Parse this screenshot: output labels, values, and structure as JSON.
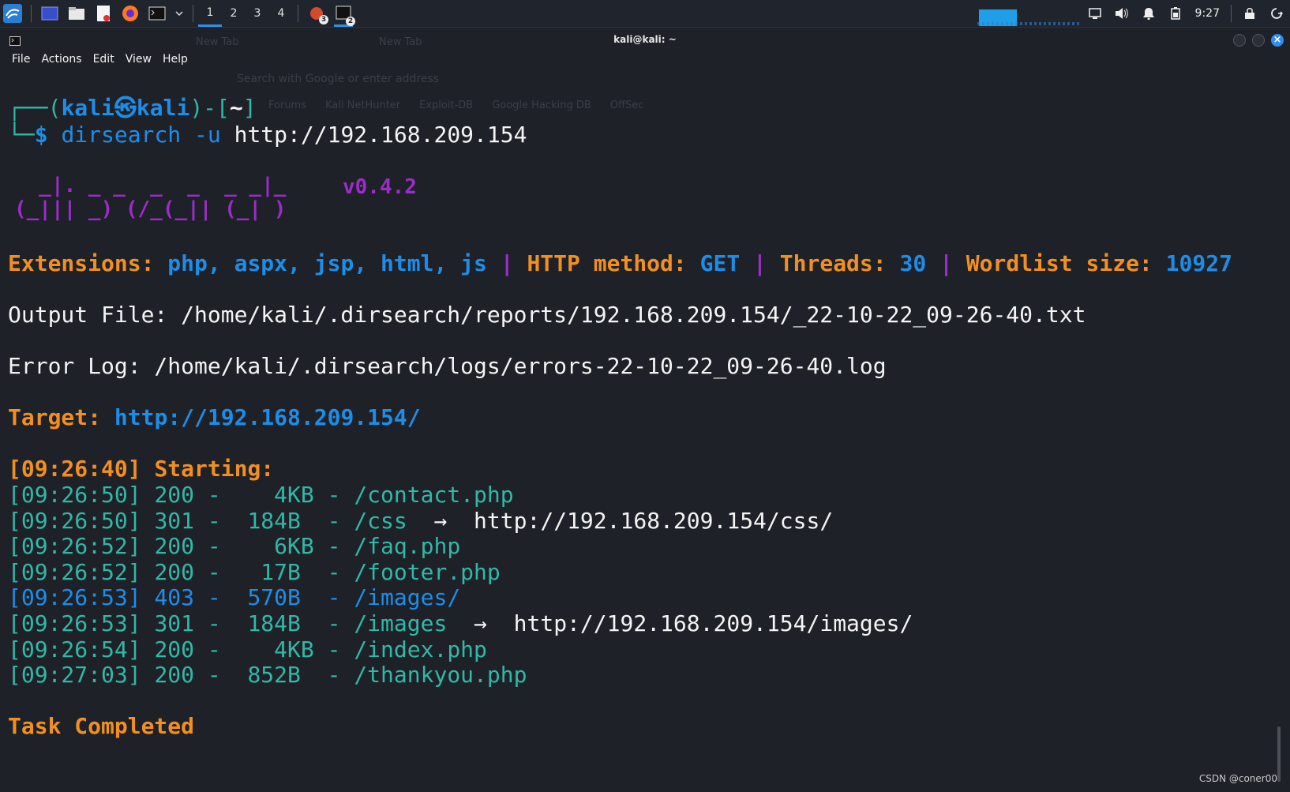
{
  "taskbar": {
    "workspaces": [
      "1",
      "2",
      "3",
      "4"
    ],
    "active_workspace": "1",
    "app_badges": {
      "network": "3",
      "terminal": "2"
    },
    "clock": "9:27",
    "colors": {
      "accent": "#2f8fe6"
    }
  },
  "window": {
    "title": "kali@kali: ~",
    "ghost_tabs": [
      "New Tab",
      "New Tab"
    ],
    "ghost_address": "Search with Google or enter address",
    "ghost_bookmarks": [
      "Forums",
      "Kali NetHunter",
      "Exploit-DB",
      "Google Hacking DB",
      "OffSec"
    ]
  },
  "menu": [
    "File",
    "Actions",
    "Edit",
    "View",
    "Help"
  ],
  "terminal": {
    "prompt": {
      "open": "┌──(",
      "user": "kali",
      "sym": "㉿",
      "host": "kali",
      "mid": ")-[",
      "dir": "~",
      "close": "]",
      "dollar_prefix": "└─",
      "dollar": "$",
      "cmd": "dirsearch -u",
      "arg": "http://192.168.209.154"
    },
    "version": "v0.4.2",
    "ascii_logo": "  _|. _ _  _  _  _ _|_\n(_||| _) (/_(_|| (_| )",
    "ext_label": "Extensions:",
    "ext_value": "php, aspx, jsp, html, js",
    "sep": "|",
    "method_label": "HTTP method:",
    "method_value": "GET",
    "threads_label": "Threads:",
    "threads_value": "30",
    "wordlist_label": "Wordlist size:",
    "wordlist_value": "10927",
    "output_file": "Output File: /home/kali/.dirsearch/reports/192.168.209.154/_22-10-22_09-26-40.txt",
    "error_log": "Error Log: /home/kali/.dirsearch/logs/errors-22-10-22_09-26-40.log",
    "target_label": "Target:",
    "target_value": "http://192.168.209.154/",
    "start_time": "[09:26:40]",
    "start_label": "Starting:",
    "results": [
      {
        "time": "[09:26:50]",
        "code": "200",
        "size": "  4KB",
        "path": "/contact.php",
        "redirect": ""
      },
      {
        "time": "[09:26:50]",
        "code": "301",
        "size": "184B ",
        "path": "/css",
        "redirect": "http://192.168.209.154/css/"
      },
      {
        "time": "[09:26:52]",
        "code": "200",
        "size": "  6KB",
        "path": "/faq.php",
        "redirect": ""
      },
      {
        "time": "[09:26:52]",
        "code": "200",
        "size": " 17B ",
        "path": "/footer.php",
        "redirect": ""
      },
      {
        "time": "[09:26:53]",
        "code": "403",
        "size": "570B ",
        "path": "/images/",
        "redirect": ""
      },
      {
        "time": "[09:26:53]",
        "code": "301",
        "size": "184B ",
        "path": "/images",
        "redirect": "http://192.168.209.154/images/"
      },
      {
        "time": "[09:26:54]",
        "code": "200",
        "size": "  4KB",
        "path": "/index.php",
        "redirect": ""
      },
      {
        "time": "[09:27:03]",
        "code": "200",
        "size": "852B ",
        "path": "/thankyou.php",
        "redirect": ""
      }
    ],
    "arrow": "→",
    "dash": "-",
    "completed": "Task Completed",
    "colors": {
      "teal": "#31b8a6",
      "blue": "#1d8ee8",
      "orange": "#f2901f",
      "purple": "#9b2dc8"
    }
  },
  "watermark": "CSDN @coner00"
}
